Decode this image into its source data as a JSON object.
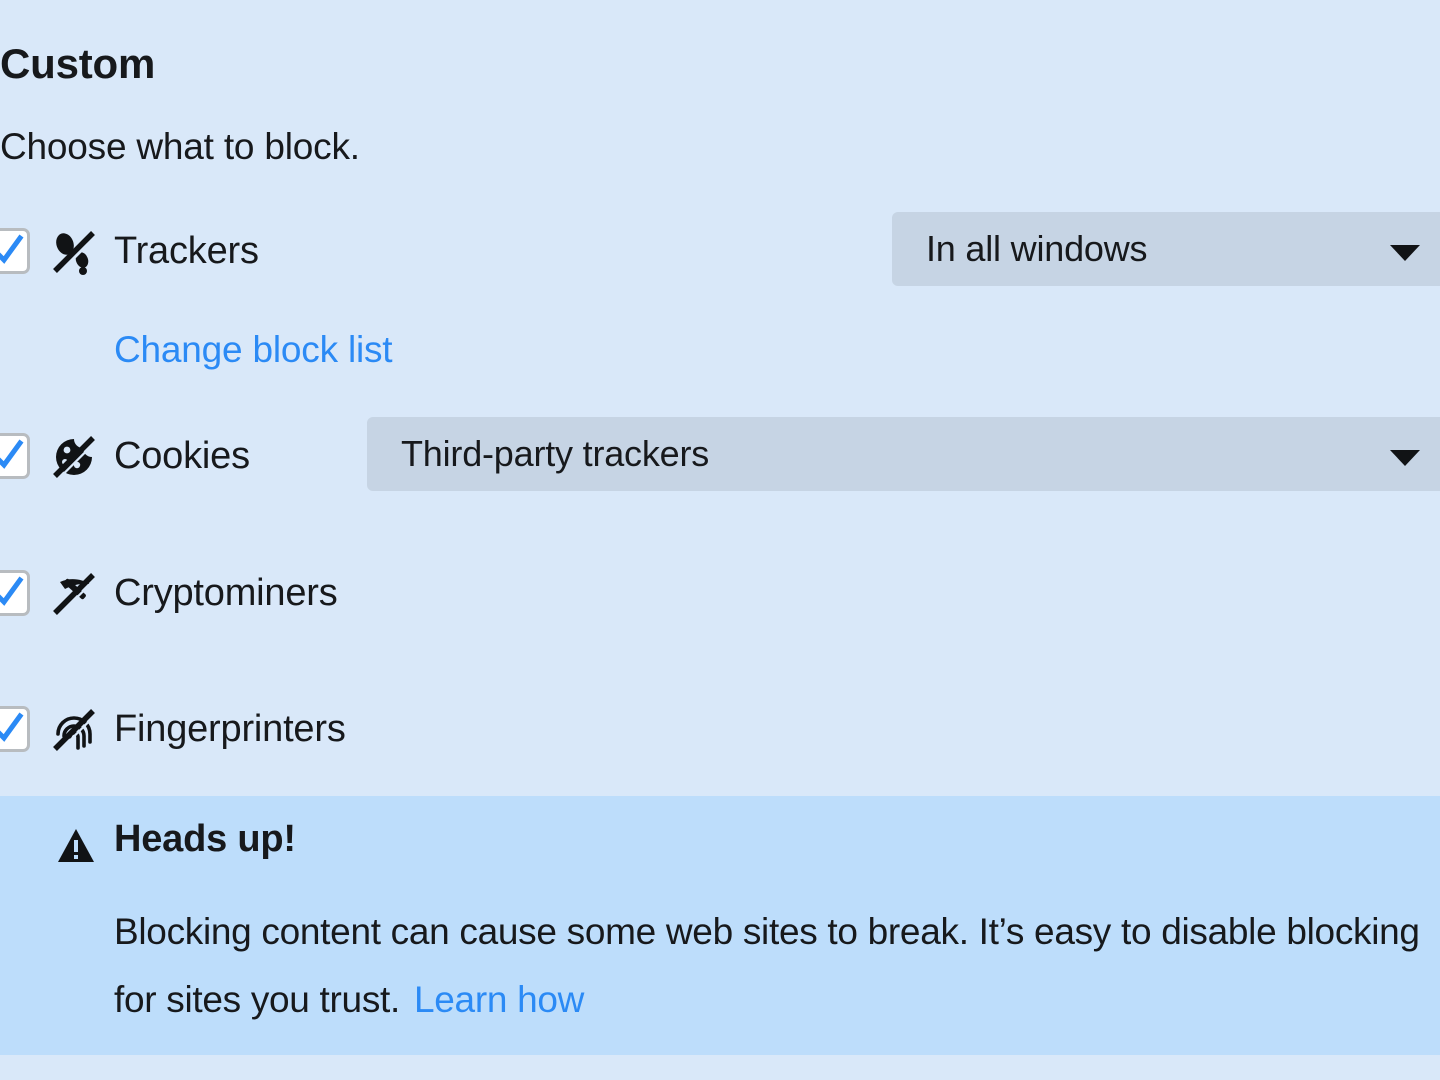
{
  "panel": {
    "title": "Custom",
    "subtitle": "Choose what to block."
  },
  "colors": {
    "background": "#d9e8f9",
    "notice_background": "#bdddfb",
    "dropdown_background": "#c6d4e4",
    "link": "#2b8af5",
    "checkbox_check": "#2b8af5",
    "text": "#17191c"
  },
  "options": [
    {
      "id": "trackers",
      "label": "Trackers",
      "icon": "trackers-blocked-icon",
      "checked": true,
      "dropdown": {
        "value": "In all windows",
        "icon": "chevron-down-icon"
      },
      "link": "Change block list"
    },
    {
      "id": "cookies",
      "label": "Cookies",
      "icon": "cookies-blocked-icon",
      "checked": true,
      "dropdown": {
        "value": "Third-party trackers",
        "icon": "chevron-down-icon"
      }
    },
    {
      "id": "cryptominers",
      "label": "Cryptominers",
      "icon": "cryptominers-blocked-icon",
      "checked": true
    },
    {
      "id": "fingerprinters",
      "label": "Fingerprinters",
      "icon": "fingerprinters-blocked-icon",
      "checked": true
    }
  ],
  "notice": {
    "icon": "warning-triangle-icon",
    "title": "Heads up!",
    "body": "Blocking content can cause some web sites to break. It’s easy to disable blocking for sites you trust.",
    "link": "Learn how"
  }
}
